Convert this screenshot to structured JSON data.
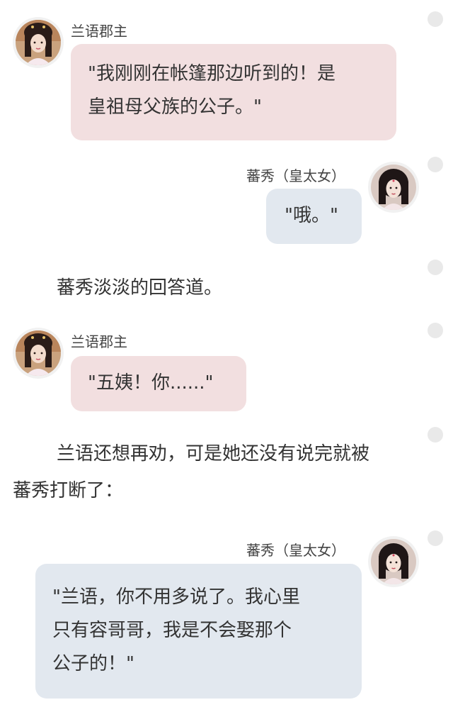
{
  "messages": [
    {
      "speaker": "兰语郡主",
      "avatar_icon": "princess-avatar-icon",
      "lines": [
        "\"我刚刚在帐篷那边听到的！是",
        "皇祖母父族的公子。\""
      ]
    },
    {
      "speaker": "蕃秀（皇太女）",
      "avatar_icon": "crown-princess-avatar-icon",
      "lines": [
        "\"哦。\""
      ]
    },
    {
      "narration": [
        "蕃秀淡淡的回答道。"
      ]
    },
    {
      "speaker": "兰语郡主",
      "avatar_icon": "princess-avatar-icon",
      "lines": [
        "\"五姨！你......\""
      ]
    },
    {
      "narration": [
        "兰语还想再劝，可是她还没有说完就被",
        "蕃秀打断了："
      ]
    },
    {
      "speaker": "蕃秀（皇太女）",
      "avatar_icon": "crown-princess-avatar-icon",
      "lines": [
        "\"兰语，你不用多说了。我心里",
        "只有容哥哥，我是不会娶那个",
        "公子的！\""
      ]
    }
  ],
  "colors": {
    "left_bubble": "#f2dfe0",
    "right_bubble": "#e2e8ef",
    "dot": "#e9e9e9",
    "text": "#333333"
  }
}
